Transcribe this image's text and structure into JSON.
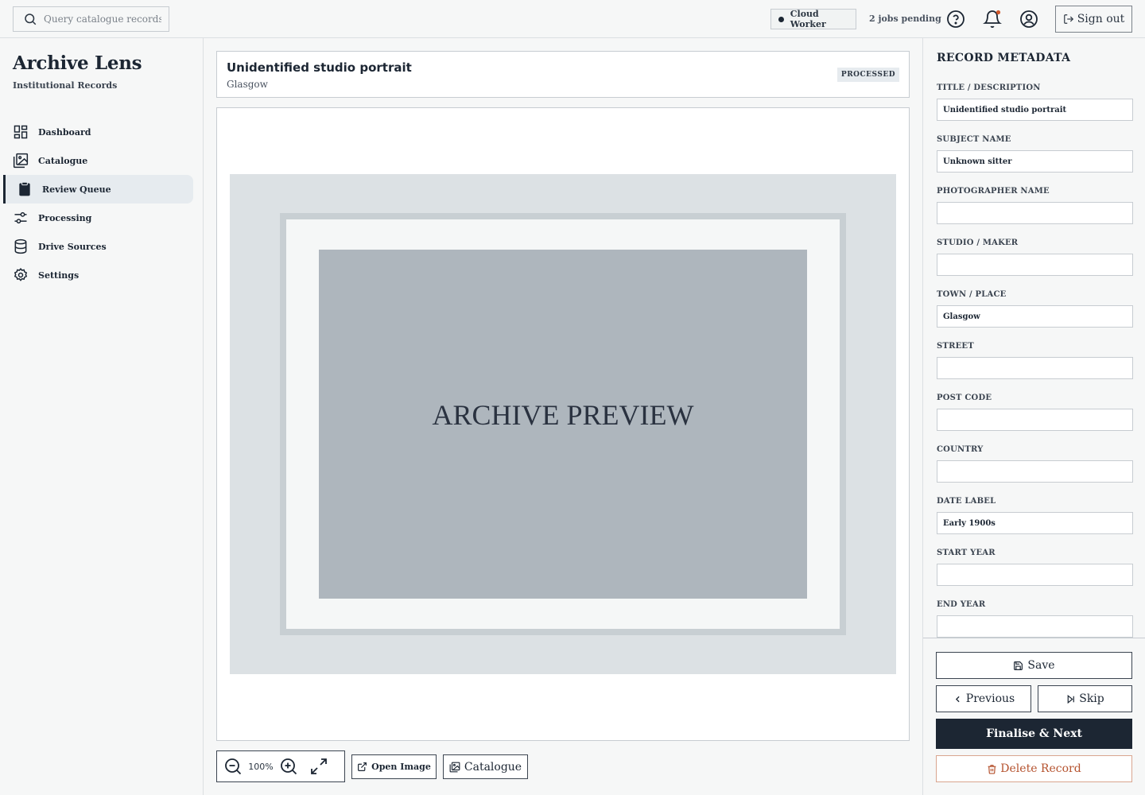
{
  "search": {
    "placeholder": "Query catalogue records, ID"
  },
  "topbar": {
    "worker_label": "Cloud Worker",
    "jobs_pending": "2 jobs pending",
    "signout_label": "Sign out",
    "icons": [
      "help-icon",
      "bell-icon",
      "user-icon"
    ]
  },
  "brand": {
    "name": "Archive Lens",
    "subtitle": "Institutional Records"
  },
  "sidebar": {
    "items": [
      {
        "label": "Dashboard",
        "icon": "grid-icon"
      },
      {
        "label": "Catalogue",
        "icon": "gallery-icon"
      },
      {
        "label": "Review Queue",
        "icon": "clipboard-icon",
        "active": true
      },
      {
        "label": "Processing",
        "icon": "sliders-icon"
      },
      {
        "label": "Drive Sources",
        "icon": "database-icon"
      },
      {
        "label": "Settings",
        "icon": "gear-icon"
      }
    ]
  },
  "record": {
    "title": "Unidentified studio portrait",
    "place": "Glasgow",
    "status": "PROCESSED"
  },
  "viewer": {
    "preview_text": "ARCHIVE PREVIEW",
    "zoom_level": "100%",
    "open_image_label": "Open Image",
    "catalogue_label": "Catalogue"
  },
  "metadata": {
    "heading": "RECORD METADATA",
    "fields": [
      {
        "label": "TITLE / DESCRIPTION",
        "value": "Unidentified studio portrait"
      },
      {
        "label": "SUBJECT NAME",
        "value": "Unknown sitter"
      },
      {
        "label": "PHOTOGRAPHER NAME",
        "value": ""
      },
      {
        "label": "STUDIO / MAKER",
        "value": ""
      },
      {
        "label": "TOWN / PLACE",
        "value": "Glasgow"
      },
      {
        "label": "STREET",
        "value": ""
      },
      {
        "label": "POST CODE",
        "value": ""
      },
      {
        "label": "COUNTRY",
        "value": ""
      },
      {
        "label": "DATE LABEL",
        "value": "Early 1900s"
      },
      {
        "label": "START YEAR",
        "value": ""
      },
      {
        "label": "END YEAR",
        "value": ""
      }
    ]
  },
  "actions": {
    "save": "Save",
    "previous": "Previous",
    "skip": "Skip",
    "finalise": "Finalise & Next",
    "delete": "Delete Record"
  },
  "colors": {
    "primary": "#1c2633",
    "danger": "#b5532f",
    "notification": "#d0582c",
    "preview_mat": "#dce1e4",
    "preview_photo": "#aeb6bd"
  }
}
